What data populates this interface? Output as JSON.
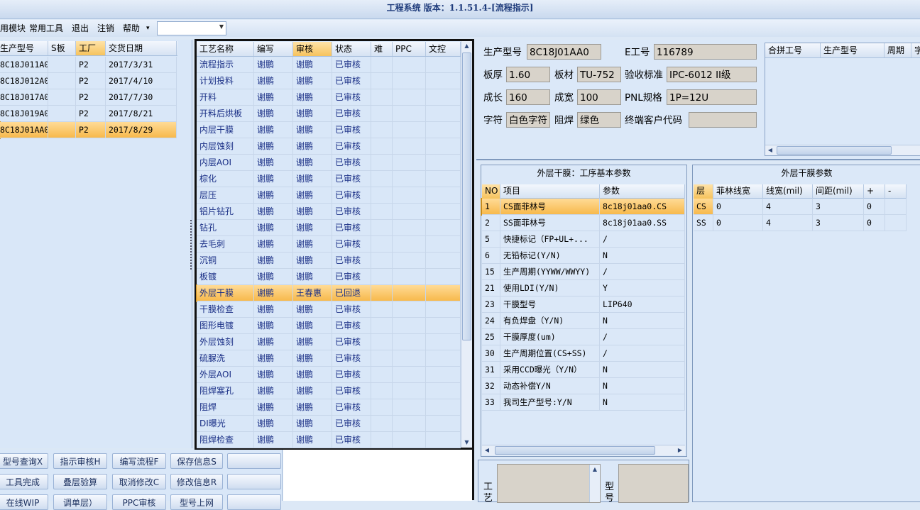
{
  "window": {
    "title": "工程系统  版本：1.1.51.4-[流程指示]"
  },
  "menu": {
    "items": [
      "用模块",
      "常用工具",
      "退出",
      "注销",
      "帮助"
    ],
    "help_arrow": "▾"
  },
  "orders": {
    "columns": [
      "生产型号",
      "S板",
      "工厂",
      "交货日期"
    ],
    "rows": [
      [
        "8C18J011A0",
        "",
        "P2",
        "2017/3/31"
      ],
      [
        "8C18J012A0",
        "",
        "P2",
        "2017/4/10"
      ],
      [
        "8C18J017A0",
        "",
        "P2",
        "2017/7/30"
      ],
      [
        "8C18J019A0",
        "",
        "P2",
        "2017/8/21"
      ],
      [
        "8C18J01AA0",
        "",
        "P2",
        "2017/8/29"
      ]
    ],
    "selected_index": 4
  },
  "process": {
    "columns": [
      "工艺名称",
      "编写",
      "审核",
      "状态",
      "难",
      "PPC",
      "文控"
    ],
    "rows": [
      [
        "流程指示",
        "谢鹏",
        "谢鹏",
        "已审核"
      ],
      [
        "计划投料",
        "谢鹏",
        "谢鹏",
        "已审核"
      ],
      [
        "开料",
        "谢鹏",
        "谢鹏",
        "已审核"
      ],
      [
        "开料后烘板",
        "谢鹏",
        "谢鹏",
        "已审核"
      ],
      [
        "内层干膜",
        "谢鹏",
        "谢鹏",
        "已审核"
      ],
      [
        "内层蚀刻",
        "谢鹏",
        "谢鹏",
        "已审核"
      ],
      [
        "内层AOI",
        "谢鹏",
        "谢鹏",
        "已审核"
      ],
      [
        "棕化",
        "谢鹏",
        "谢鹏",
        "已审核"
      ],
      [
        "层压",
        "谢鹏",
        "谢鹏",
        "已审核"
      ],
      [
        "铝片钻孔",
        "谢鹏",
        "谢鹏",
        "已审核"
      ],
      [
        "钻孔",
        "谢鹏",
        "谢鹏",
        "已审核"
      ],
      [
        "去毛刺",
        "谢鹏",
        "谢鹏",
        "已审核"
      ],
      [
        "沉铜",
        "谢鹏",
        "谢鹏",
        "已审核"
      ],
      [
        "板镀",
        "谢鹏",
        "谢鹏",
        "已审核"
      ],
      [
        "外层干膜",
        "谢鹏",
        "王春惠",
        "已回退"
      ],
      [
        "干膜检查",
        "谢鹏",
        "谢鹏",
        "已审核"
      ],
      [
        "图形电镀",
        "谢鹏",
        "谢鹏",
        "已审核"
      ],
      [
        "外层蚀刻",
        "谢鹏",
        "谢鹏",
        "已审核"
      ],
      [
        "硫脲洗",
        "谢鹏",
        "谢鹏",
        "已审核"
      ],
      [
        "外层AOI",
        "谢鹏",
        "谢鹏",
        "已审核"
      ],
      [
        "阻焊塞孔",
        "谢鹏",
        "谢鹏",
        "已审核"
      ],
      [
        "阻焊",
        "谢鹏",
        "谢鹏",
        "已审核"
      ],
      [
        "DI曝光",
        "谢鹏",
        "谢鹏",
        "已审核"
      ],
      [
        "阻焊检查",
        "谢鹏",
        "谢鹏",
        "已审核"
      ]
    ],
    "selected_index": 14
  },
  "info": {
    "model_label": "生产型号",
    "model": "8C18J01AA0",
    "e_label": "E工号",
    "e_value": "116789",
    "thick_label": "板厚",
    "thick": "1.60",
    "material_label": "板材",
    "material": "TU-752",
    "std_label": "验收标准",
    "std": "IPC-6012 II级",
    "grow_label": "成长",
    "grow": "160",
    "width_label": "成宽",
    "width": "100",
    "pnl_label": "PNL规格",
    "pnl": "1P=12U",
    "char_label": "字符",
    "char": "白色字符",
    "mask_label": "阻焊",
    "mask": "绿色",
    "cust_label": "终端客户代码",
    "cust": ""
  },
  "merge": {
    "columns": [
      "合拼工号",
      "生产型号",
      "周期",
      "字"
    ]
  },
  "params": {
    "title": "外层干膜：工序基本参数",
    "columns": [
      "NO",
      "项目",
      "参数"
    ],
    "rows": [
      [
        "1",
        "CS面菲林号",
        "8c18j01aa0.CS"
      ],
      [
        "2",
        "SS面菲林号",
        "8c18j01aa0.SS"
      ],
      [
        "5",
        "快捷标记（FP+UL+...",
        "/"
      ],
      [
        "6",
        "无铅标记(Y/N)",
        "N"
      ],
      [
        "15",
        "生产周期(YYWW/WWYY)",
        "/"
      ],
      [
        "21",
        "使用LDI(Y/N)",
        "Y"
      ],
      [
        "23",
        "干膜型号",
        "LIP640"
      ],
      [
        "24",
        "有负焊盘（Y/N)",
        "N"
      ],
      [
        "25",
        "干膜厚度(um)",
        "/"
      ],
      [
        "30",
        "生产周期位置(CS+SS)",
        "/"
      ],
      [
        "31",
        "采用CCD曝光（Y/N）",
        "N"
      ],
      [
        "32",
        "动态补偿Y/N",
        "N"
      ],
      [
        "33",
        "我司生产型号:Y/N",
        "N"
      ]
    ],
    "selected_index": 0
  },
  "film": {
    "title": "外层干膜参数",
    "columns": [
      "层",
      "菲林线宽",
      "线宽(mil)",
      "间距(mil)",
      "+",
      "-"
    ],
    "rows": [
      [
        "CS",
        "0",
        "4",
        "3",
        "0",
        ""
      ],
      [
        "SS",
        "0",
        "4",
        "3",
        "0",
        ""
      ]
    ]
  },
  "bottom": {
    "label_a": "工艺",
    "label_b": "型号"
  },
  "buttons": {
    "row1": [
      "型号查询X",
      "指示审核H",
      "编写流程F",
      "保存信息S",
      ""
    ],
    "row2": [
      "工具完成",
      "叠层验算",
      "取消修改C",
      "修改信息R",
      ""
    ],
    "row3": [
      "在线WIP",
      "调单层）",
      "PPC审核",
      "型号上网",
      ""
    ]
  },
  "colors": {
    "accent": "#f7b94c",
    "text_blue": "#1a2f86",
    "title": "#1f3c7c"
  }
}
